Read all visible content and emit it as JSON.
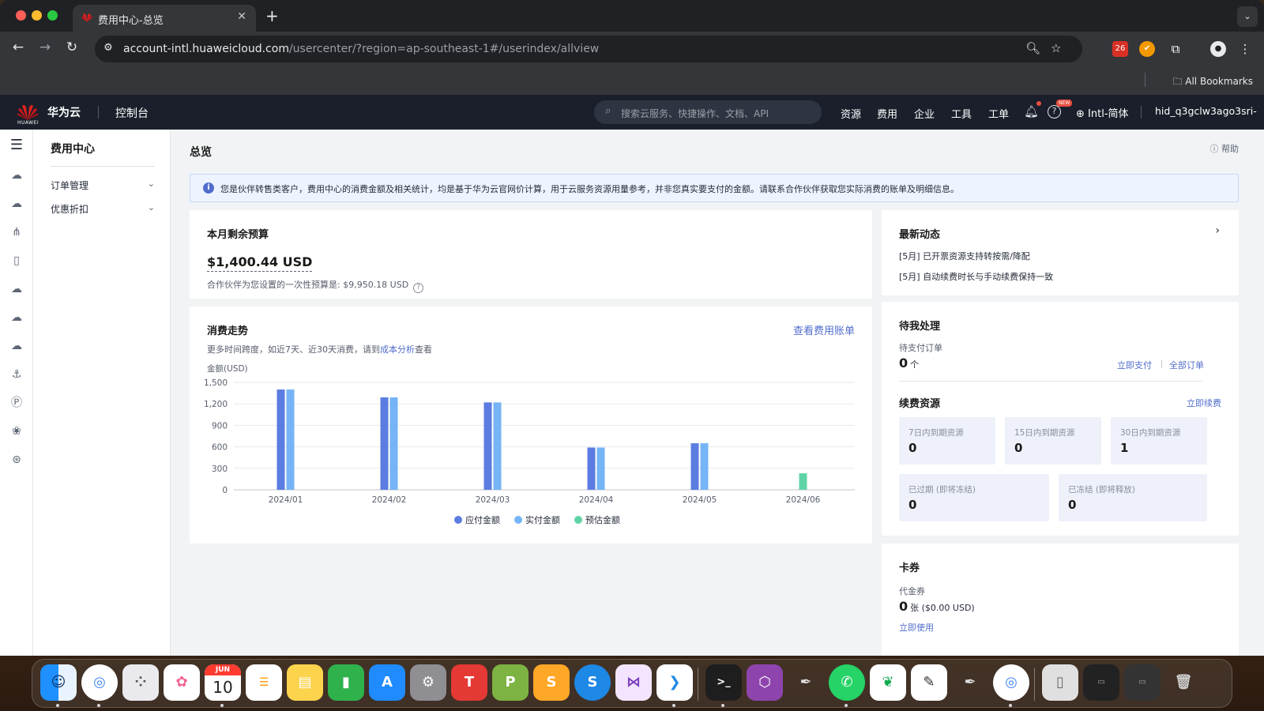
{
  "browser": {
    "tab_title": "费用中心-总览",
    "url_host": "account-intl.huaweicloud.com",
    "url_path": "/usercenter/?region=ap-southeast-1#/userindex/allview",
    "ext_badge": "26",
    "bookmarks_label": "All Bookmarks"
  },
  "header": {
    "brand": "华为云",
    "logo_text": "HUAWEI",
    "console": "控制台",
    "search_placeholder": "搜索云服务、快捷操作、文档、API",
    "nav": [
      "资源",
      "费用",
      "企业",
      "工具",
      "工单"
    ],
    "new_badge": "NEW",
    "language": "Intl-简体",
    "username": "hid_q3gclw3ago3sri-"
  },
  "sidenav": {
    "title": "费用中心",
    "items": [
      {
        "label": "订单管理"
      },
      {
        "label": "优惠折扣"
      }
    ]
  },
  "page": {
    "title": "总览",
    "help": "帮助",
    "notice": "您是伙伴转售类客户，费用中心的消费金额及相关统计，均是基于华为云官网价计算，用于云服务资源用量参考，并非您真实要支付的金额。请联系合作伙伴获取您实际消费的账单及明细信息。"
  },
  "budget": {
    "title": "本月剩余预算",
    "amount": "$1,400.44 USD",
    "sub": "合作伙伴为您设置的一次性预算是: $9,950.18 USD"
  },
  "trend": {
    "title": "消费走势",
    "link": "查看费用账单",
    "sub_prefix": "更多时间跨度，如近7天、近30天消费，请到",
    "sub_link": "成本分析",
    "sub_suffix": "查看"
  },
  "news": {
    "title": "最新动态",
    "items": [
      "[5月] 已开票资源支持转按需/降配",
      "[5月] 自动续费时长与手动续费保持一致"
    ]
  },
  "todo": {
    "title": "待我处理",
    "pending_label": "待支付订单",
    "pending_value": "0",
    "pending_unit": "个",
    "pay_now": "立即支付",
    "all_orders": "全部订单",
    "renew_title": "续费资源",
    "renew_now": "立即续费",
    "stats": [
      {
        "label": "7日内到期资源",
        "value": "0"
      },
      {
        "label": "15日内到期资源",
        "value": "0"
      },
      {
        "label": "30日内到期资源",
        "value": "1"
      },
      {
        "label": "已过期 (即将冻结)",
        "value": "0"
      },
      {
        "label": "已冻结 (即将释放)",
        "value": "0"
      }
    ]
  },
  "coupon": {
    "title": "卡券",
    "label": "代金券",
    "value": "0",
    "unit": "张 ($0.00 USD)",
    "use_now": "立即使用"
  },
  "dock": {
    "calendar_month": "JUN",
    "calendar_day": "10"
  },
  "chart_data": {
    "type": "bar",
    "ylabel": "金额(USD)",
    "ylim": [
      0,
      1500
    ],
    "yticks": [
      0,
      300,
      600,
      900,
      1200,
      1500
    ],
    "categories": [
      "2024/01",
      "2024/02",
      "2024/03",
      "2024/04",
      "2024/05",
      "2024/06"
    ],
    "series": [
      {
        "name": "应付金额",
        "color": "#5b7ce0",
        "values": [
          1400,
          1290,
          1220,
          590,
          650,
          0
        ]
      },
      {
        "name": "实付金额",
        "color": "#75b4f5",
        "values": [
          1400,
          1290,
          1220,
          590,
          650,
          0
        ]
      },
      {
        "name": "预估金额",
        "color": "#5fd3a6",
        "values": [
          0,
          0,
          0,
          0,
          0,
          230
        ]
      }
    ],
    "grid": true,
    "legend": "bottom"
  }
}
